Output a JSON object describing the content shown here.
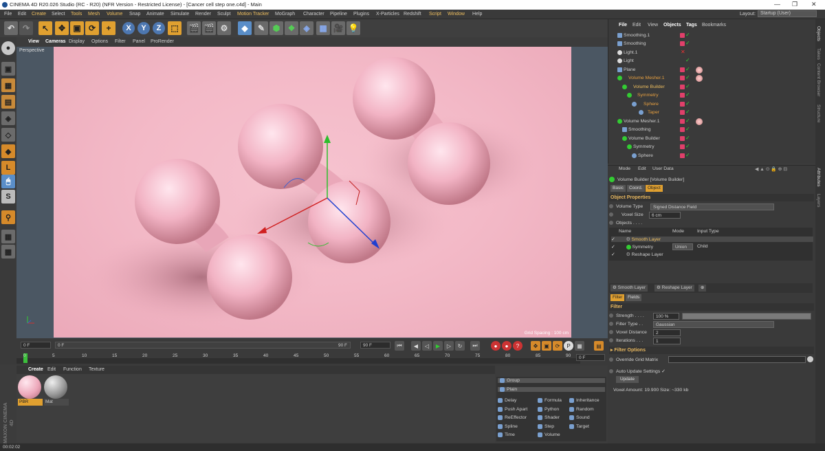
{
  "titlebar": {
    "title": "CINEMA 4D R20.026 Studio (RC - R20) (NFR Version - Restricted License) - [Cancer cell step one.c4d] - Main",
    "min": "—",
    "max": "❐",
    "close": "✕"
  },
  "menubar": {
    "items": [
      "File",
      "Edit",
      "Create",
      "Select",
      "Tools",
      "Mesh",
      "Volume",
      "Snap",
      "Animate",
      "Simulate",
      "Render",
      "Sculpt",
      "Motion Tracker",
      "MoGraph",
      "Character",
      "Pipeline",
      "Plugins",
      "X-Particles",
      "Redshift",
      "Script",
      "Window",
      "Help"
    ],
    "layout_label": "Layout:",
    "layout_value": "Startup (User)"
  },
  "viewport": {
    "menu": [
      "View",
      "Cameras",
      "Display",
      "Options",
      "Filter",
      "Panel",
      "ProRender"
    ],
    "camera_label": "Perspective",
    "grid_spacing": "Grid Spacing : 100 cm",
    "bg_color": "#f3b9c7"
  },
  "timeline": {
    "start_field": "0 F",
    "cur_field": "0 F",
    "end_field": "90 F",
    "end2_field": "90 F",
    "frame_field": "0 F",
    "ticks": [
      "0",
      "5",
      "10",
      "15",
      "20",
      "25",
      "30",
      "35",
      "40",
      "45",
      "50",
      "55",
      "60",
      "65",
      "70",
      "75",
      "80",
      "85",
      "90"
    ]
  },
  "materials": {
    "menu": [
      "Create",
      "Edit",
      "Function",
      "Texture"
    ],
    "items": [
      {
        "label": "PBR"
      },
      {
        "label": "Mat"
      }
    ]
  },
  "nodes": {
    "group": "Group",
    "plain": "Plain",
    "col1": [
      "Delay",
      "Push Apart",
      "ReEffector",
      "Spline",
      "Time"
    ],
    "col2": [
      "Formula",
      "Python",
      "Shader",
      "Step",
      "Volume"
    ],
    "col3": [
      "Inheritance",
      "Random",
      "Sound",
      "Target"
    ]
  },
  "status": {
    "time": "00:02:02",
    "brand_line1": "MAXON",
    "brand_line2": "CINEMA 4D"
  },
  "objects": {
    "menu": [
      "File",
      "Edit",
      "View",
      "Objects",
      "Tags",
      "Bookmarks"
    ],
    "rows": [
      {
        "name": "Smoothing.1",
        "indent": 1,
        "hl": false
      },
      {
        "name": "Smoothing",
        "indent": 1,
        "hl": false
      },
      {
        "name": "Light.1",
        "indent": 1,
        "hl": false
      },
      {
        "name": "Light",
        "indent": 1,
        "hl": false
      },
      {
        "name": "Plane",
        "indent": 1,
        "hl": false
      },
      {
        "name": "Volume Mesher.1",
        "indent": 1,
        "hl": true
      },
      {
        "name": "Volume Builder",
        "indent": 2,
        "hl": true
      },
      {
        "name": "Symmetry",
        "indent": 3,
        "hl": true
      },
      {
        "name": "Sphere",
        "indent": 4,
        "hl": true
      },
      {
        "name": "Taper",
        "indent": 5,
        "hl": true
      },
      {
        "name": "Volume Mesher.1",
        "indent": 1,
        "hl": false
      },
      {
        "name": "Smoothing",
        "indent": 2,
        "hl": false
      },
      {
        "name": "Volume Builder",
        "indent": 2,
        "hl": false
      },
      {
        "name": "Symmetry",
        "indent": 3,
        "hl": false
      },
      {
        "name": "Sphere",
        "indent": 4,
        "hl": false
      }
    ]
  },
  "right_tabs": [
    "Objects",
    "Takes",
    "Content Browser",
    "Structure",
    "Attributes",
    "Layers"
  ],
  "attributes": {
    "menu": [
      "Mode",
      "Edit",
      "User Data"
    ],
    "title": "Volume Builder [Volume Builder]",
    "tabs": [
      "Basic",
      "Coord.",
      "Object"
    ],
    "section": "Object Properties",
    "volume_type_label": "Volume Type",
    "volume_type_value": "Signed Distance Field",
    "voxel_size_label": "Voxel Size",
    "voxel_size_value": "6 cm",
    "objects_label": "Objects . . . .",
    "table_headers": [
      "Name",
      "Mode",
      "Input Type"
    ],
    "table_rows": [
      {
        "name": "Smooth Layer",
        "mode": "",
        "input": ""
      },
      {
        "name": "Symmetry",
        "mode": "Union",
        "input": "Child"
      },
      {
        "name": "Reshape Layer",
        "mode": "",
        "input": ""
      }
    ],
    "layer_tabs": [
      "Smooth Layer",
      "Reshape Layer"
    ],
    "sub_tabs": [
      "Filter",
      "Fields"
    ],
    "filter_section": "Filter",
    "strength_label": "Strength . . . .",
    "strength_value": "100 %",
    "strength_level": 1.0,
    "filter_type_label": "Filter Type . .",
    "filter_type_value": "Gaussian",
    "voxel_distance_label": "Voxel Distance",
    "voxel_distance_value": "2",
    "iterations_label": "Iterations . . .",
    "iterations_value": "1",
    "filter_options": "Filter Options",
    "override_label": "Override Grid Matrix",
    "auto_update_label": "Auto Update Settings",
    "auto_update_check": "✓",
    "update_button": "Update",
    "voxel_amount": "Voxel Amount: 19.900   Size: ~330 kb"
  }
}
